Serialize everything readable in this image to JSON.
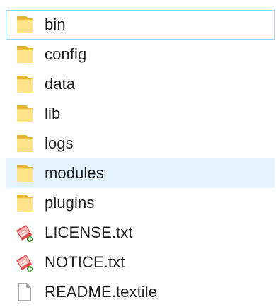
{
  "explorer": {
    "items": [
      {
        "name": "bin",
        "type": "folder",
        "icon": "folder-icon",
        "state": "selected"
      },
      {
        "name": "config",
        "type": "folder",
        "icon": "folder-icon",
        "state": ""
      },
      {
        "name": "data",
        "type": "folder",
        "icon": "folder-icon",
        "state": ""
      },
      {
        "name": "lib",
        "type": "folder",
        "icon": "folder-icon",
        "state": ""
      },
      {
        "name": "logs",
        "type": "folder",
        "icon": "folder-icon",
        "state": ""
      },
      {
        "name": "modules",
        "type": "folder",
        "icon": "folder-icon",
        "state": "hover"
      },
      {
        "name": "plugins",
        "type": "folder",
        "icon": "folder-icon",
        "state": ""
      },
      {
        "name": "LICENSE.txt",
        "type": "file",
        "icon": "text-document-icon",
        "state": ""
      },
      {
        "name": "NOTICE.txt",
        "type": "file",
        "icon": "text-document-icon",
        "state": ""
      },
      {
        "name": "README.textile",
        "type": "file",
        "icon": "blank-file-icon",
        "state": ""
      }
    ]
  },
  "colors": {
    "folder_front": "#ffe48a",
    "folder_back": "#e8b632",
    "selection_border": "#99d1ff",
    "hover_background": "#e5f3ff"
  }
}
